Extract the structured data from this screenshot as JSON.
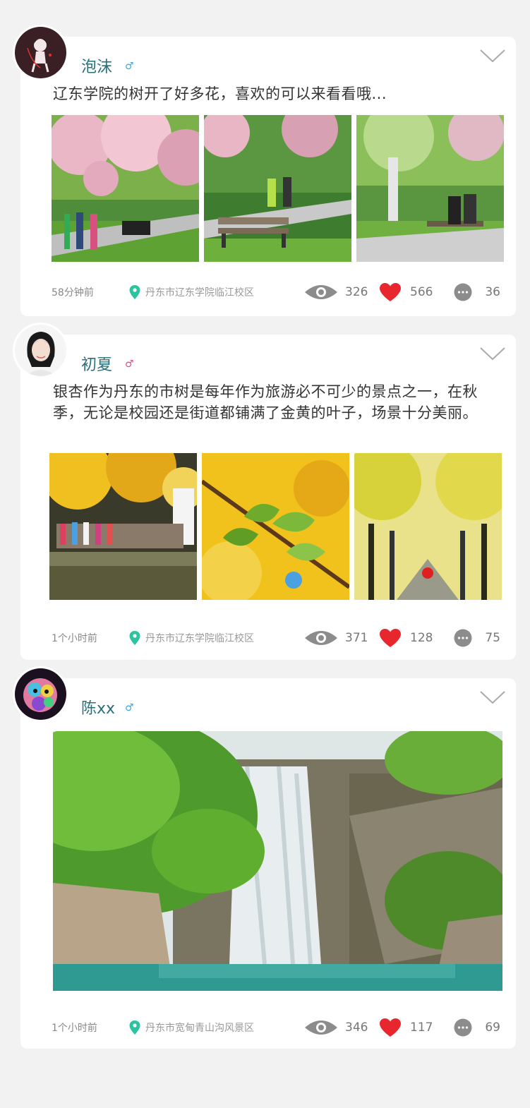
{
  "posts": [
    {
      "username": "泡沫",
      "gender_symbol": "♂",
      "text": "辽东学院的树开了好多花，喜欢的可以来看看哦...",
      "time": "58分钟前",
      "location": "丹东市辽东学院临江校区",
      "views": "326",
      "likes": "566",
      "comments": "36"
    },
    {
      "username": "初夏",
      "gender_symbol": "♂",
      "text": "银杏作为丹东的市树是每年作为旅游必不可少的景点之一，在秋季，无论是校园还是街道都铺满了金黄的叶子，场景十分美丽。",
      "time": "1个小时前",
      "location": "丹东市辽东学院临江校区",
      "views": "371",
      "likes": "128",
      "comments": "75"
    },
    {
      "username": "陈xx",
      "gender_symbol": "♂",
      "text": "",
      "time": "1个小时前",
      "location": "丹东市宽甸青山沟风景区",
      "views": "346",
      "likes": "117",
      "comments": "69"
    }
  ],
  "colors": {
    "username": "#2a6f7a",
    "male": "#3aa6e6",
    "female": "#e04a8e",
    "heart": "#e8262d",
    "pin": "#2bc3a0",
    "icon_grey": "#8c8c8c"
  },
  "icons": [
    "chevron-down-icon",
    "location-pin-icon",
    "eye-icon",
    "heart-icon",
    "comment-icon",
    "male-icon",
    "female-icon"
  ]
}
